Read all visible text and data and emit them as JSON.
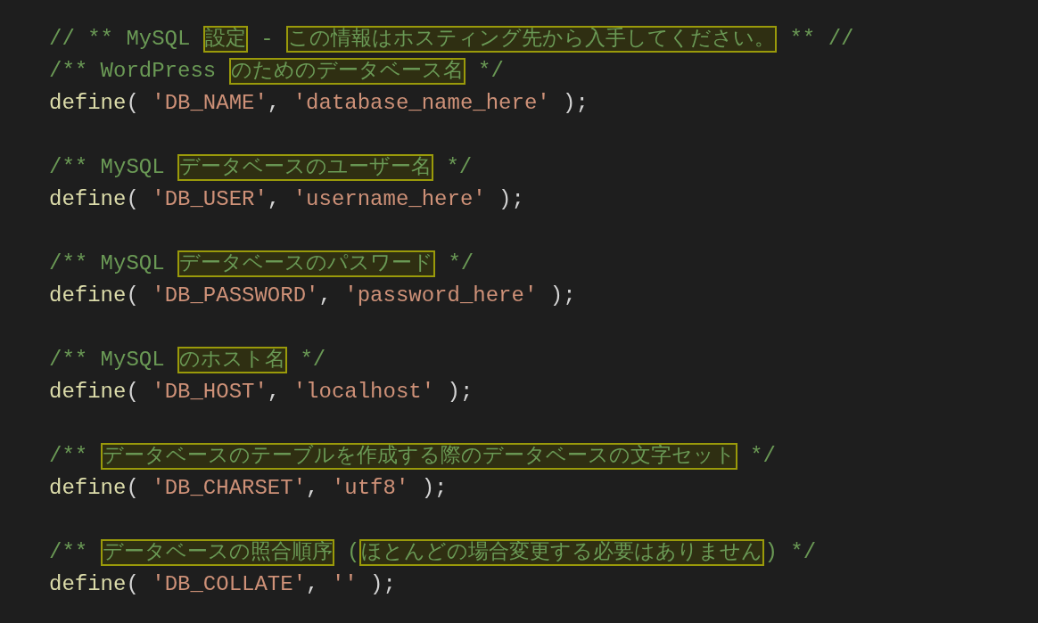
{
  "editor": {
    "lines": [
      {
        "kind": "comment",
        "segments": [
          {
            "kind": "comment",
            "text": "// ** MySQL "
          },
          {
            "kind": "flagged",
            "text": "設定"
          },
          {
            "kind": "comment",
            "text": " - "
          },
          {
            "kind": "flagged",
            "text": "この情報はホスティング先から入手してください。"
          },
          {
            "kind": "comment",
            "text": " ** //"
          }
        ]
      },
      {
        "kind": "comment",
        "segments": [
          {
            "kind": "comment",
            "text": "/** WordPress "
          },
          {
            "kind": "flagged",
            "text": "のためのデータベース名"
          },
          {
            "kind": "comment",
            "text": " */"
          }
        ]
      },
      {
        "kind": "code",
        "segments": [
          {
            "kind": "function",
            "text": "define"
          },
          {
            "kind": "punct",
            "text": "( "
          },
          {
            "kind": "string",
            "text": "'DB_NAME'"
          },
          {
            "kind": "punct",
            "text": ", "
          },
          {
            "kind": "string",
            "text": "'database_name_here'"
          },
          {
            "kind": "punct",
            "text": " );"
          }
        ]
      },
      {
        "kind": "comment",
        "segments": [
          {
            "kind": "comment",
            "text": "/** MySQL "
          },
          {
            "kind": "flagged",
            "text": "データベースのユーザー名"
          },
          {
            "kind": "comment",
            "text": " */"
          }
        ]
      },
      {
        "kind": "code",
        "segments": [
          {
            "kind": "function",
            "text": "define"
          },
          {
            "kind": "punct",
            "text": "( "
          },
          {
            "kind": "string",
            "text": "'DB_USER'"
          },
          {
            "kind": "punct",
            "text": ", "
          },
          {
            "kind": "string",
            "text": "'username_here'"
          },
          {
            "kind": "punct",
            "text": " );"
          }
        ]
      },
      {
        "kind": "comment",
        "segments": [
          {
            "kind": "comment",
            "text": "/** MySQL "
          },
          {
            "kind": "flagged",
            "text": "データベースのパスワード"
          },
          {
            "kind": "comment",
            "text": " */"
          }
        ]
      },
      {
        "kind": "code",
        "segments": [
          {
            "kind": "function",
            "text": "define"
          },
          {
            "kind": "punct",
            "text": "( "
          },
          {
            "kind": "string",
            "text": "'DB_PASSWORD'"
          },
          {
            "kind": "punct",
            "text": ", "
          },
          {
            "kind": "string",
            "text": "'password_here'"
          },
          {
            "kind": "punct",
            "text": " );"
          }
        ]
      },
      {
        "kind": "comment",
        "segments": [
          {
            "kind": "comment",
            "text": "/** MySQL "
          },
          {
            "kind": "flagged",
            "text": "のホスト名"
          },
          {
            "kind": "comment",
            "text": " */"
          }
        ]
      },
      {
        "kind": "code",
        "segments": [
          {
            "kind": "function",
            "text": "define"
          },
          {
            "kind": "punct",
            "text": "( "
          },
          {
            "kind": "string",
            "text": "'DB_HOST'"
          },
          {
            "kind": "punct",
            "text": ", "
          },
          {
            "kind": "string",
            "text": "'localhost'"
          },
          {
            "kind": "punct",
            "text": " );"
          }
        ]
      },
      {
        "kind": "comment",
        "segments": [
          {
            "kind": "comment",
            "text": "/** "
          },
          {
            "kind": "flagged",
            "text": "データベースのテーブルを作成する際のデータベースの文字セット"
          },
          {
            "kind": "comment",
            "text": " */"
          }
        ]
      },
      {
        "kind": "code",
        "segments": [
          {
            "kind": "function",
            "text": "define"
          },
          {
            "kind": "punct",
            "text": "( "
          },
          {
            "kind": "string",
            "text": "'DB_CHARSET'"
          },
          {
            "kind": "punct",
            "text": ", "
          },
          {
            "kind": "string",
            "text": "'utf8'"
          },
          {
            "kind": "punct",
            "text": " );"
          }
        ]
      },
      {
        "kind": "comment",
        "segments": [
          {
            "kind": "comment",
            "text": "/** "
          },
          {
            "kind": "flagged",
            "text": "データベースの照合順序"
          },
          {
            "kind": "comment",
            "text": " ("
          },
          {
            "kind": "flagged",
            "text": "ほとんどの場合変更する必要はありません"
          },
          {
            "kind": "comment",
            "text": ") */"
          }
        ]
      },
      {
        "kind": "code",
        "segments": [
          {
            "kind": "function",
            "text": "define"
          },
          {
            "kind": "punct",
            "text": "( "
          },
          {
            "kind": "string",
            "text": "'DB_COLLATE'"
          },
          {
            "kind": "punct",
            "text": ", "
          },
          {
            "kind": "string",
            "text": "''"
          },
          {
            "kind": "punct",
            "text": " );"
          }
        ]
      }
    ]
  }
}
